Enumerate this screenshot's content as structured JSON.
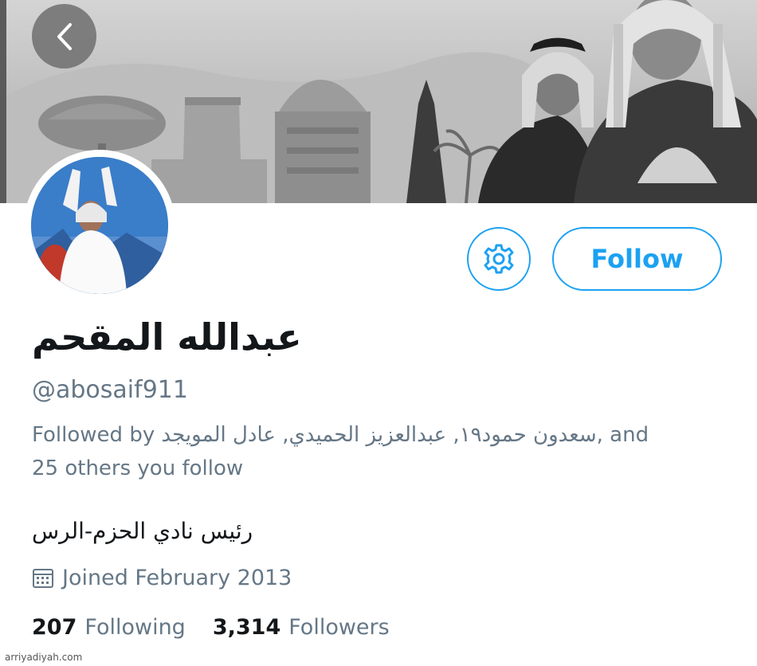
{
  "profile": {
    "name": "عبدالله المقحم",
    "handle": "@abosaif911",
    "followed_by_prefix": "Followed by",
    "followed_by_names": "سعدون حمود١٩, عبدالعزيز الحميدي, عادل المويجد",
    "followed_by_suffix": ", and",
    "followed_by_others": "25 others you follow",
    "bio": "رئيس نادي الحزم-الرس",
    "joined": "Joined February 2013"
  },
  "actions": {
    "follow_label": "Follow"
  },
  "stats": {
    "following_count": "207",
    "following_label": "Following",
    "followers_count": "3,314",
    "followers_label": "Followers"
  },
  "watermark": "arriyadiyah.com",
  "icons": {
    "back": "chevron-left-icon",
    "settings": "gear-icon",
    "calendar": "calendar-icon"
  },
  "colors": {
    "accent": "#1da1f2",
    "secondary_text": "#657786",
    "primary_text": "#14171a"
  }
}
